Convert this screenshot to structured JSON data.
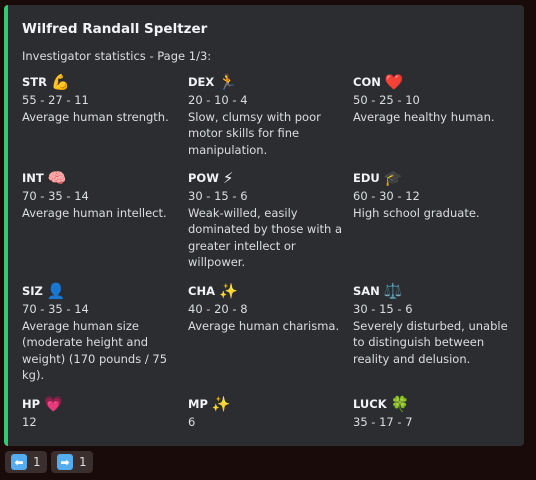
{
  "embed": {
    "accent_color": "#2ecc71",
    "title": "Wilfred Randall Speltzer",
    "subtitle": "Investigator statistics - Page 1/3:"
  },
  "stats": [
    {
      "name": "STR",
      "icon": "💪",
      "icon_name": "flexed-biceps-icon",
      "value": "55 - 27 - 11",
      "desc": "Average human strength."
    },
    {
      "name": "DEX",
      "icon": "🏃",
      "icon_name": "running-person-icon",
      "value": "20 - 10 - 4",
      "desc": "Slow, clumsy with poor motor skills for fine manipulation."
    },
    {
      "name": "CON",
      "icon": "❤️",
      "icon_name": "red-heart-icon",
      "value": "50 - 25 - 10",
      "desc": "Average healthy human."
    },
    {
      "name": "INT",
      "icon": "🧠",
      "icon_name": "brain-icon",
      "value": "70 - 35 - 14",
      "desc": "Average human intellect."
    },
    {
      "name": "POW",
      "icon": "⚡",
      "icon_name": "lightning-icon",
      "value": "30 - 15 - 6",
      "desc": "Weak-willed, easily dominated by those with a greater intellect or willpower."
    },
    {
      "name": "EDU",
      "icon": "🎓",
      "icon_name": "graduation-cap-icon",
      "value": "60 - 30 - 12",
      "desc": "High school graduate."
    },
    {
      "name": "SIZ",
      "icon": "👤",
      "icon_name": "person-silhouette-icon",
      "value": "70 - 35 - 14",
      "desc": "Average human size (moderate height and weight) (170 pounds / 75 kg)."
    },
    {
      "name": "CHA",
      "icon": "✨",
      "icon_name": "sparkles-icon",
      "value": "40 - 20 - 8",
      "desc": "Average human charisma."
    },
    {
      "name": "SAN",
      "icon": "⚖️",
      "icon_name": "balance-scale-icon",
      "value": "30 - 15 - 6",
      "desc": "Severely disturbed, unable to distinguish between reality and delusion."
    },
    {
      "name": "HP",
      "icon": "💗",
      "icon_name": "pink-heart-icon",
      "value": "12",
      "desc": ""
    },
    {
      "name": "MP",
      "icon": "✨",
      "icon_name": "sparkles-icon",
      "value": "6",
      "desc": ""
    },
    {
      "name": "LUCK",
      "icon": "🍀",
      "icon_name": "four-leaf-clover-icon",
      "value": "35 - 17 - 7",
      "desc": ""
    }
  ],
  "buttons": [
    {
      "icon": "⬅",
      "icon_name": "left-arrow-icon",
      "count": "1"
    },
    {
      "icon": "➡",
      "icon_name": "right-arrow-icon",
      "count": "1"
    }
  ]
}
